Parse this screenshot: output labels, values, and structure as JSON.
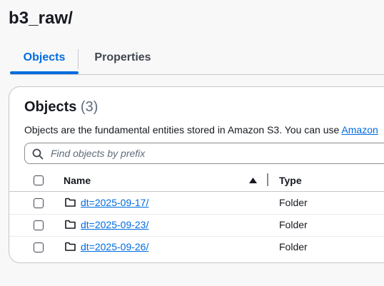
{
  "page": {
    "title": "b3_raw/"
  },
  "tabs": [
    {
      "label": "Objects",
      "selected": true
    },
    {
      "label": "Properties",
      "selected": false
    }
  ],
  "objects_panel": {
    "heading": "Objects",
    "count": "(3)",
    "description": "Objects are the fundamental entities stored in Amazon S3. You can use ",
    "description_link": "Amazon",
    "search": {
      "placeholder": "Find objects by prefix",
      "value": ""
    },
    "table": {
      "columns": {
        "name": "Name",
        "type": "Type"
      },
      "sort": "ascending",
      "rows": [
        {
          "name": "dt=2025-09-17/",
          "type": "Folder",
          "icon": "folder-icon"
        },
        {
          "name": "dt=2025-09-23/",
          "type": "Folder",
          "icon": "folder-icon"
        },
        {
          "name": "dt=2025-09-26/",
          "type": "Folder",
          "icon": "folder-icon"
        }
      ]
    }
  },
  "colors": {
    "accent": "#006ce0",
    "text": "#16191f",
    "muted": "#5f6b7a",
    "border": "#c6c6cd",
    "background": "#f8f8f8"
  }
}
